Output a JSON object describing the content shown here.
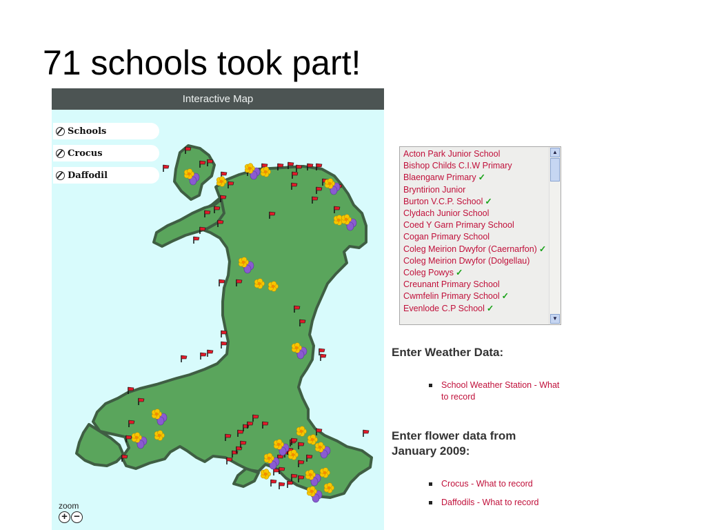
{
  "slide": {
    "title": "71 schools took part!"
  },
  "map": {
    "header": "Interactive Map",
    "layers": [
      {
        "label": "Schools"
      },
      {
        "label": "Crocus"
      },
      {
        "label": "Daffodil"
      }
    ],
    "zoom_label": "zoom",
    "zoom_in": "+",
    "zoom_out": "−",
    "colors": {
      "land": "#5aa55c",
      "coast": "#3f5e43",
      "sea": "#d8fbfc",
      "flag": "#e01b2a",
      "daffodil": "#f7c600",
      "crocus": "#8a5bd1"
    },
    "markers": {
      "flags_count_shown": 71,
      "icons": [
        "school-flag-icon",
        "crocus-icon",
        "daffodil-icon"
      ]
    }
  },
  "school_list": {
    "items": [
      {
        "name": "Acton Park Junior School",
        "tick": ""
      },
      {
        "name": "Bishop Childs C.I.W Primary",
        "tick": ""
      },
      {
        "name": "Blaengarw Primary",
        "tick": "✓"
      },
      {
        "name": "Bryntirion Junior",
        "tick": ""
      },
      {
        "name": "Burton V.C.P. School",
        "tick": "✓"
      },
      {
        "name": "Clydach Junior School",
        "tick": ""
      },
      {
        "name": "Coed Y Garn Primary School",
        "tick": ""
      },
      {
        "name": "Cogan Primary School",
        "tick": ""
      },
      {
        "name": "Coleg Meirion Dwyfor (Caernarfon)",
        "tick": "✓"
      },
      {
        "name": "Coleg Meirion Dwyfor (Dolgellau)",
        "tick": ""
      },
      {
        "name": "Coleg Powys",
        "tick": "✓"
      },
      {
        "name": "Creunant Primary School",
        "tick": ""
      },
      {
        "name": "Cwmfelin Primary School",
        "tick": "✓"
      },
      {
        "name": "Evenlode C.P School",
        "tick": "✓"
      }
    ]
  },
  "weather": {
    "heading": "Enter Weather Data:",
    "links": [
      "School Weather Station - What to record"
    ]
  },
  "flowers": {
    "heading": "Enter flower data from January 2009:",
    "links": [
      "Crocus - What to record",
      "Daffodils - What to record"
    ]
  }
}
